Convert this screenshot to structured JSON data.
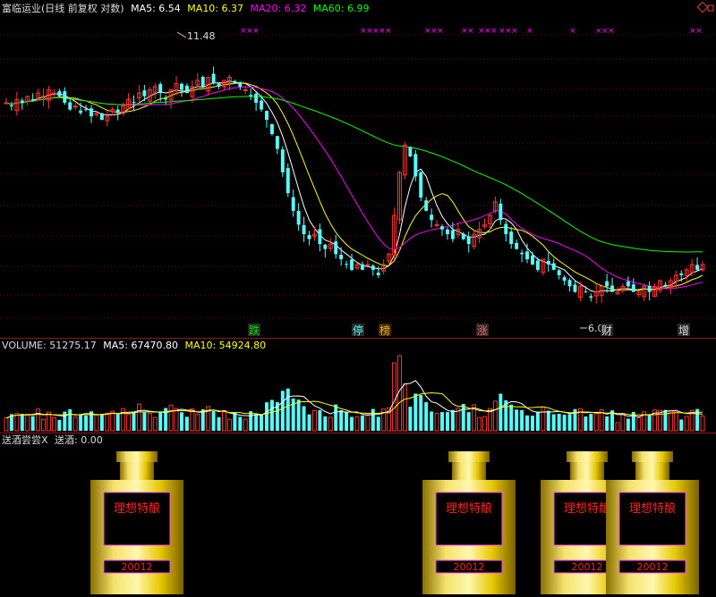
{
  "price_header": {
    "title": "富临运业(日线 前复权 对数)",
    "ma5": "MA5: 6.54",
    "ma10": "MA10: 6.37",
    "ma20": "MA20: 6.32",
    "ma60": "MA60: 6.99",
    "colors": {
      "title": "#dcdcdc",
      "ma5": "#ffffff",
      "ma10": "#ffff00",
      "ma20": "#ff00ff",
      "ma60": "#00ff00"
    }
  },
  "volume_header": {
    "volume": "VOLUME: 51275.17",
    "ma5": "MA5: 67470.80",
    "ma10": "MA10: 54924.80"
  },
  "indicator_header": {
    "name": "送酒尝尝X",
    "value": "送酒: 0.00"
  },
  "price_annotations": {
    "high": "11.48",
    "low": "6.0",
    "events": [
      "跌",
      "停",
      "榜",
      "涨",
      "财",
      "增"
    ]
  },
  "jar_labels": {
    "brand": "理想特酿",
    "code": "20012"
  },
  "colors": {
    "up": "#ff3232",
    "down": "#54ffff",
    "ma5": "#ffffff",
    "ma10": "#ffff00",
    "ma20": "#ff00ff",
    "ma60": "#00ff00",
    "marker": "#ff00ff",
    "gold": "#e6c800"
  },
  "chart_data": [
    {
      "type": "candlestick",
      "title": "富临运业(日线 前复权 对数)",
      "scale": "log",
      "ylim": [
        5.6,
        13.4
      ],
      "annotations": {
        "max": 11.48,
        "min": 6.0
      },
      "series": [
        {
          "name": "MA5",
          "last": 6.54
        },
        {
          "name": "MA10",
          "last": 6.37
        },
        {
          "name": "MA20",
          "last": 6.32
        },
        {
          "name": "MA60",
          "last": 6.99
        }
      ],
      "close": [
        10.5,
        10.4,
        10.6,
        10.5,
        10.7,
        10.6,
        10.8,
        10.7,
        10.9,
        10.8,
        10.7,
        10.5,
        10.3,
        10.4,
        10.2,
        10.3,
        10.1,
        10.2,
        10.0,
        10.1,
        10.3,
        10.2,
        10.4,
        10.6,
        10.5,
        10.8,
        10.7,
        10.9,
        11.0,
        10.8,
        10.6,
        10.9,
        11.1,
        10.9,
        10.8,
        11.0,
        11.2,
        11.0,
        11.3,
        11.1,
        11.0,
        11.2,
        11.3,
        11.1,
        11.0,
        10.9,
        10.7,
        10.5,
        10.3,
        10.0,
        9.6,
        9.2,
        8.6,
        8.1,
        7.7,
        7.4,
        7.2,
        7.1,
        7.2,
        7.0,
        6.9,
        7.0,
        6.8,
        6.7,
        6.6,
        6.5,
        6.6,
        6.5,
        6.6,
        6.5,
        6.4,
        6.6,
        6.8,
        7.6,
        8.6,
        9.3,
        9.0,
        8.5,
        8.0,
        7.7,
        7.5,
        7.4,
        7.3,
        7.2,
        7.1,
        7.3,
        7.1,
        7.0,
        7.2,
        7.3,
        7.4,
        7.6,
        7.9,
        7.5,
        7.2,
        7.0,
        6.9,
        6.8,
        6.7,
        6.6,
        6.5,
        6.7,
        6.6,
        6.5,
        6.4,
        6.3,
        6.2,
        6.1,
        6.2,
        6.1,
        6.0,
        6.1,
        6.2,
        6.2,
        6.1,
        6.1,
        6.2,
        6.2,
        6.1,
        6.1,
        6.2,
        6.1,
        6.2,
        6.3,
        6.2,
        6.3,
        6.4,
        6.4,
        6.5,
        6.6,
        6.5,
        6.6
      ]
    },
    {
      "type": "bar",
      "title": "VOLUME",
      "series": [
        {
          "name": "VOLUME",
          "last": 51275.17
        },
        {
          "name": "MA5",
          "last": 67470.8
        },
        {
          "name": "MA10",
          "last": 54924.8
        }
      ]
    },
    {
      "type": "bar",
      "title": "送酒尝尝X",
      "series": [
        {
          "name": "送酒",
          "last": 0.0
        }
      ]
    }
  ]
}
